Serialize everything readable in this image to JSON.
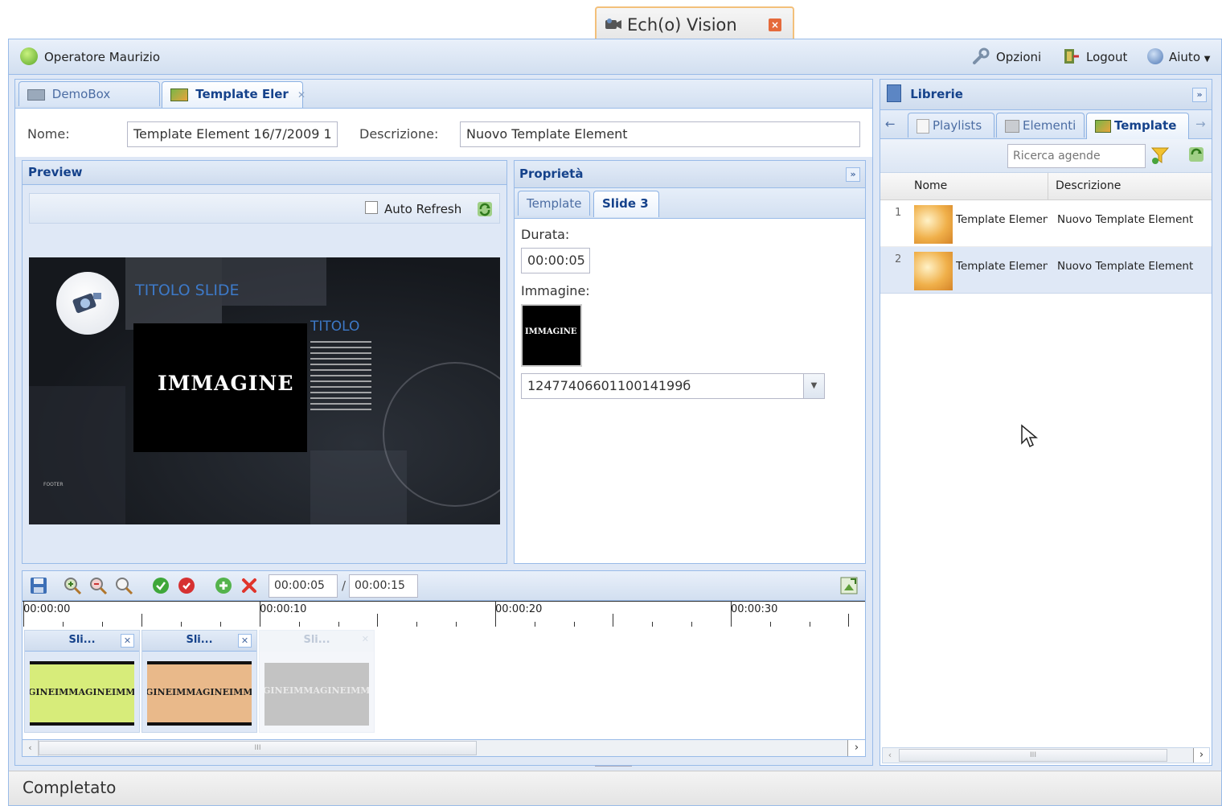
{
  "window": {
    "title": "Ech(o) Vision"
  },
  "topbar": {
    "user": "Operatore Maurizio",
    "options_label": "Opzioni",
    "logout_label": "Logout",
    "help_label": "Aiuto"
  },
  "editor": {
    "tabs": [
      {
        "label": "DemoBox"
      },
      {
        "label": "Template Eler"
      }
    ],
    "name_label": "Nome:",
    "name_value": "Template Element 16/7/2009 1",
    "desc_label": "Descrizione:",
    "desc_value": "Nuovo Template Element"
  },
  "preview": {
    "title": "Preview",
    "auto_refresh_label": "Auto Refresh",
    "slide": {
      "title_text": "TITOLO SLIDE",
      "subtitle_text": "TITOLO",
      "image_text": "IMMAGINE",
      "footer_text": "FOOTER"
    }
  },
  "properties": {
    "title": "Proprietà",
    "tabs": [
      {
        "label": "Template"
      },
      {
        "label": "Slide 3"
      }
    ],
    "duration_label": "Durata:",
    "duration_value": "00:00:05",
    "image_label": "Immagine:",
    "image_thumb_text": "IMMAGINE",
    "image_select_value": "1247740660110014199б"
  },
  "timeline": {
    "current_time": "00:00:05",
    "separator": "/",
    "total_time": "00:00:15",
    "ruler": [
      "00:00:00",
      "00:00:10",
      "00:00:20",
      "00:00:30"
    ],
    "clips": [
      {
        "label": "Sli...",
        "thumb_text": "GINEIMMAGINEIMM",
        "color": "#d7ec7a"
      },
      {
        "label": "Sli...",
        "thumb_text": "GINEIMMAGINEIMM",
        "color": "#e9b98a"
      },
      {
        "label": "Sli...",
        "thumb_text": "GINEIMMAGINEIMM",
        "color": "#b0b0b0"
      }
    ],
    "scroll_grip": "III"
  },
  "library": {
    "title": "Librerie",
    "tabs": [
      {
        "label": "Playlists"
      },
      {
        "label": "Elementi"
      },
      {
        "label": "Template"
      }
    ],
    "search_placeholder": "Ricerca agende",
    "columns": {
      "name": "Nome",
      "description": "Descrizione"
    },
    "rows": [
      {
        "index": "1",
        "name": "Template Elemen",
        "description": "Nuovo Template Element"
      },
      {
        "index": "2",
        "name": "Template Elemen",
        "description": "Nuovo Template Element"
      }
    ],
    "scroll_grip": "III"
  },
  "status": {
    "text": "Completato"
  },
  "colors": {
    "border_blue": "#99bbe8",
    "header_text": "#15428b",
    "selected_row": "#dfe8f6"
  }
}
